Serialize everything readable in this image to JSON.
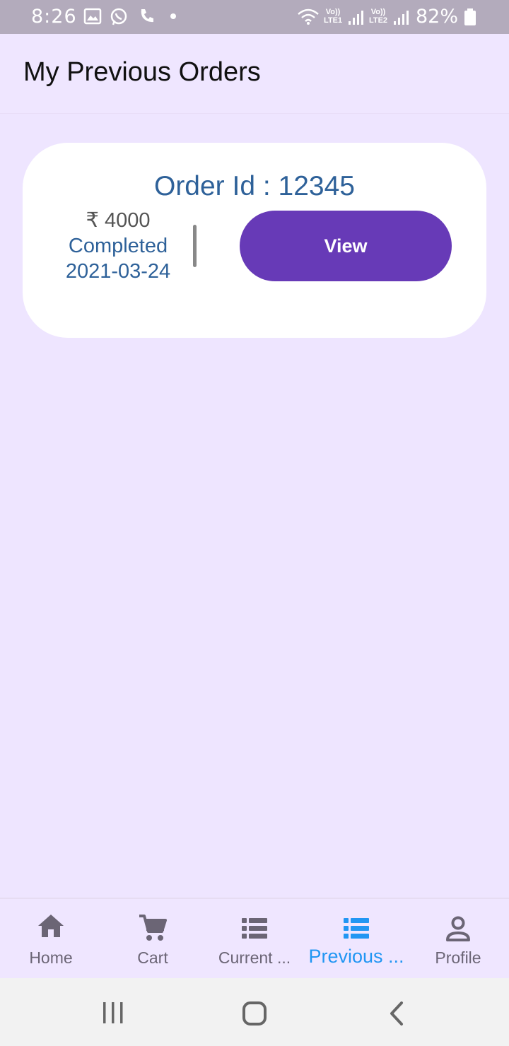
{
  "status_bar": {
    "time": "8:26",
    "battery": "82%",
    "sim1_label": "Vo)) LTE1",
    "sim2_label": "Vo)) LTE2",
    "icons": [
      "gallery-icon",
      "whatsapp-icon",
      "phone-icon",
      "dot-icon",
      "wifi-icon",
      "signal-icon",
      "battery-icon"
    ]
  },
  "app_bar": {
    "title": "My Previous Orders"
  },
  "orders": [
    {
      "order_id_text": "Order Id : 12345",
      "amount": "₹ 4000",
      "status": "Completed",
      "date": "2021-03-24",
      "view_label": "View"
    }
  ],
  "bottom_nav": {
    "items": [
      {
        "label": "Home",
        "icon": "home-icon"
      },
      {
        "label": "Cart",
        "icon": "cart-icon"
      },
      {
        "label": "Current ...",
        "icon": "list-icon"
      },
      {
        "label": "Previous ...",
        "icon": "list-icon",
        "active": true
      },
      {
        "label": "Profile",
        "icon": "person-icon"
      }
    ]
  },
  "colors": {
    "background": "#EEE5FF",
    "accent": "#673AB7",
    "text_blue": "#2E6199",
    "nav_active": "#2196F3",
    "nav_inactive": "#6B6575"
  }
}
